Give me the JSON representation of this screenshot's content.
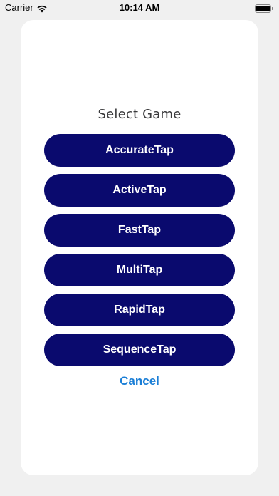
{
  "status_bar": {
    "carrier": "Carrier",
    "time": "10:14 AM",
    "icons": [
      "wifi-icon",
      "battery-icon"
    ]
  },
  "sheet": {
    "title": "Select Game",
    "games": [
      {
        "label": "AccurateTap"
      },
      {
        "label": "ActiveTap"
      },
      {
        "label": "FastTap"
      },
      {
        "label": "MultiTap"
      },
      {
        "label": "RapidTap"
      },
      {
        "label": "SequenceTap"
      }
    ],
    "cancel_label": "Cancel"
  },
  "colors": {
    "button_bg": "#0a0a6e",
    "button_text": "#ffffff",
    "cancel_text": "#1a7ed6",
    "page_bg": "#f0f0f0",
    "sheet_bg": "#ffffff"
  }
}
